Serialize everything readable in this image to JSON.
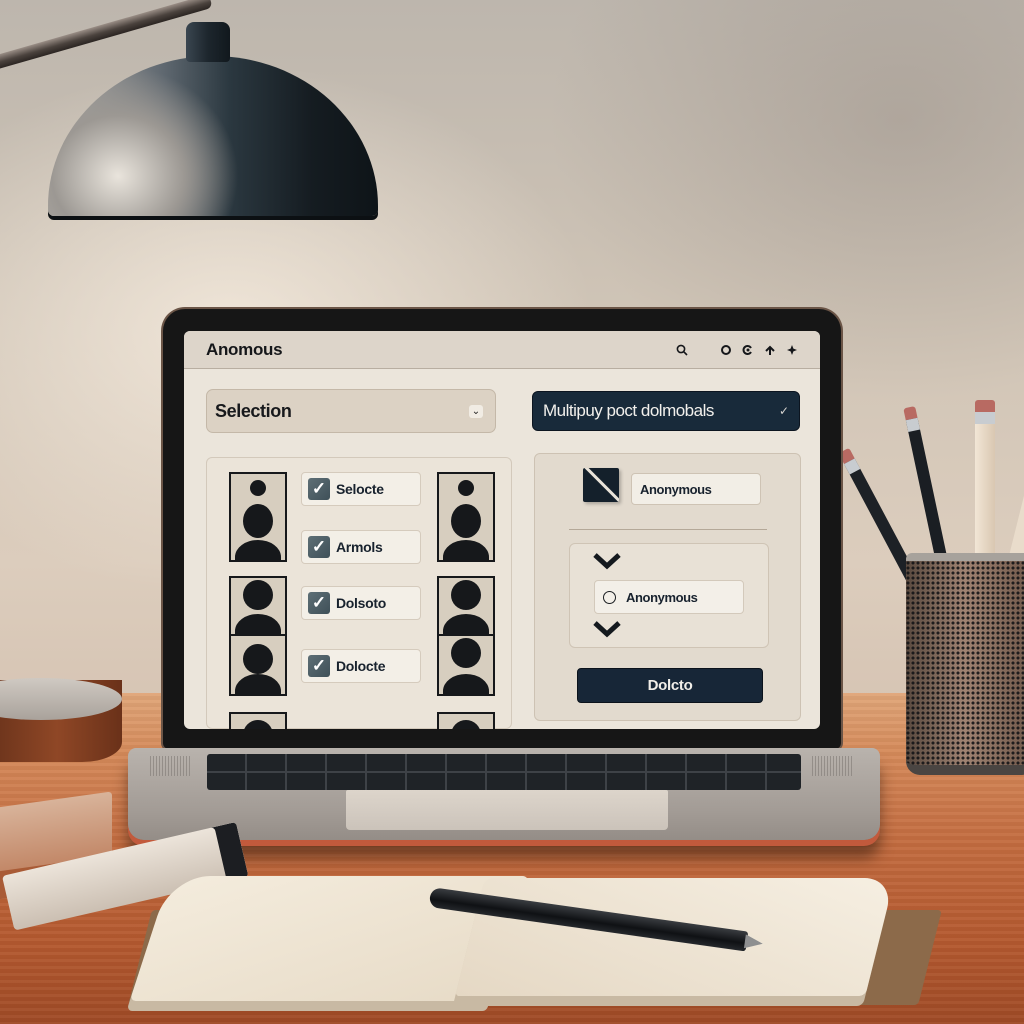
{
  "window": {
    "title": "Anomous",
    "icons": [
      "search-icon",
      "circle-icon",
      "refresh-icon",
      "arrow-icon",
      "star-icon"
    ]
  },
  "toolbar": {
    "selection_dropdown": {
      "label": "Selection",
      "icon": "chevron-down-icon"
    },
    "mode_dropdown": {
      "label": "Multipuy poct dolmobals",
      "icon": "chevron-down-icon"
    }
  },
  "left_panel": {
    "items": [
      {
        "label": "Selocte",
        "checked": true
      },
      {
        "label": "Armols",
        "checked": true
      },
      {
        "label": "Dolsoto",
        "checked": true
      },
      {
        "label": "Dolocte",
        "checked": true
      }
    ],
    "check_glyph": "✓",
    "avatar_icon": "user-silhouette-icon"
  },
  "right_panel": {
    "toggle_icon": "slash-toggle-icon",
    "name_field_value": "Anonymous",
    "radio_option": {
      "label": "Anonymous",
      "selected": false
    },
    "delete_button": "Dolcto"
  },
  "colors": {
    "accent_dark": "#172637",
    "screen_bg": "#ebe5db",
    "checkbox": "#4f6068"
  }
}
